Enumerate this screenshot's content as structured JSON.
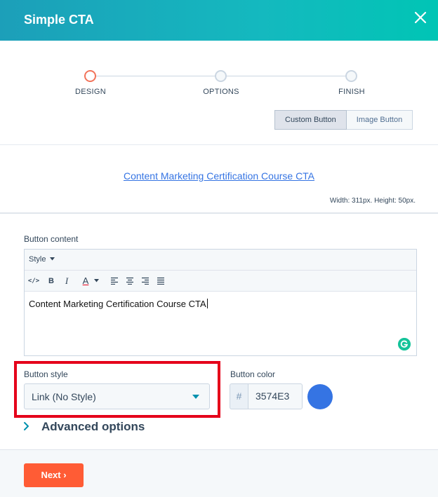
{
  "header": {
    "title": "Simple CTA",
    "close_icon": "close-icon"
  },
  "steps": [
    {
      "label": "DESIGN",
      "active": true
    },
    {
      "label": "OPTIONS",
      "active": false
    },
    {
      "label": "FINISH",
      "active": false
    }
  ],
  "button_type": {
    "custom": "Custom Button",
    "image": "Image Button",
    "selected": "Custom Button"
  },
  "preview": {
    "link_text": "Content Marketing Certification Course CTA",
    "size_text": "Width: 311px. Height: 50px."
  },
  "editor": {
    "label": "Button content",
    "style_dropdown": "Style",
    "toolbar": {
      "source": "</>",
      "bold": "B",
      "italic": "I",
      "font_color": "A"
    },
    "content": "Content Marketing Certification Course CTA"
  },
  "button_style": {
    "label": "Button style",
    "value": "Link (No Style)"
  },
  "button_color": {
    "label": "Button color",
    "prefix": "#",
    "value": "3574E3",
    "swatch": "#3574e3"
  },
  "advanced": {
    "label": "Advanced options"
  },
  "footer": {
    "next_label": "Next ›"
  },
  "colors": {
    "accent": "#ff5c35",
    "header": "#14b9bf",
    "highlight": "#e5001a"
  }
}
